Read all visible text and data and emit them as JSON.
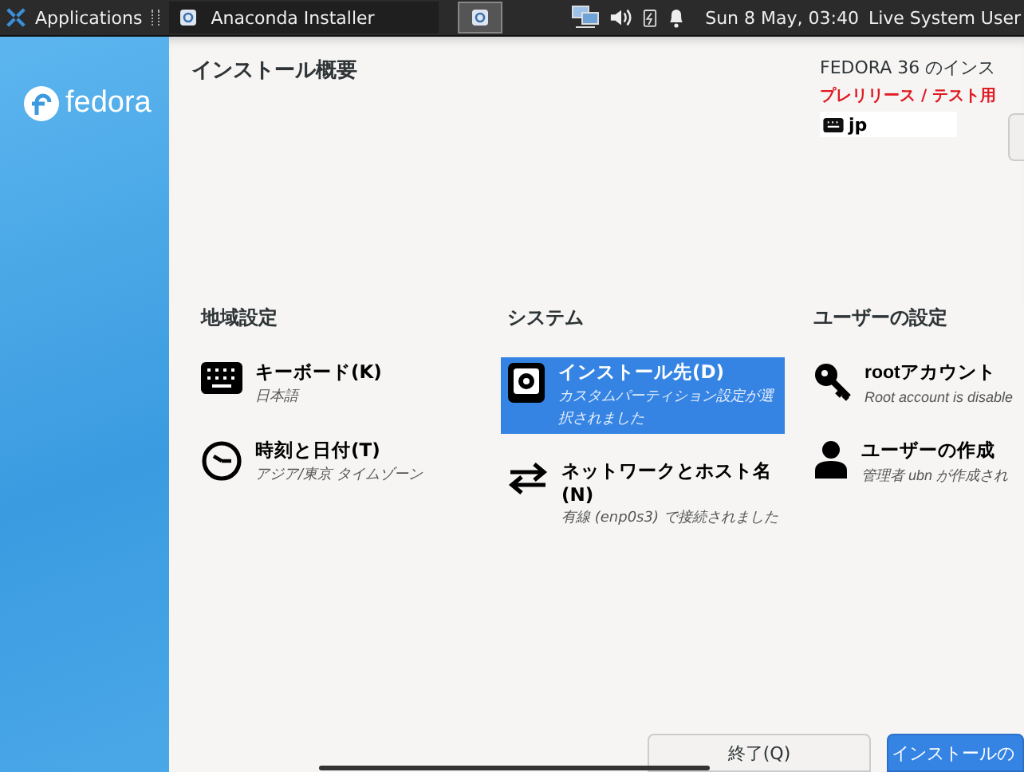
{
  "taskbar": {
    "apps_label": "Applications",
    "window_title": "Anaconda Installer",
    "clock": "Sun  8 May, 03:40",
    "user": "Live System User"
  },
  "sidebar": {
    "logo_text": "fedora"
  },
  "header": {
    "title": "インストール概要",
    "product": "FEDORA 36 のインス",
    "prerelease": "プレリリース / テスト用",
    "keyboard_layout": "jp"
  },
  "categories": [
    {
      "title": "地域設定",
      "spokes": [
        {
          "name": "キーボード(K)",
          "status": "日本語",
          "selected": false
        },
        {
          "name": "時刻と日付(T)",
          "status": "アジア/東京 タイムゾーン",
          "selected": false
        }
      ]
    },
    {
      "title": "システム",
      "spokes": [
        {
          "name": "インストール先(D)",
          "status": "カスタムパーティション設定が選択されました",
          "selected": true
        },
        {
          "name": "ネットワークとホスト名(N)",
          "status": "有線 (enp0s3) で接続されました",
          "selected": false
        }
      ]
    },
    {
      "title": "ユーザーの設定",
      "spokes": [
        {
          "name": "rootアカウント",
          "status": "Root account is disable",
          "selected": false
        },
        {
          "name": "ユーザーの作成",
          "status": "管理者 ubn が作成され",
          "selected": false
        }
      ]
    }
  ],
  "buttons": [
    {
      "label": "終了(Q)",
      "kind": "secondary"
    },
    {
      "label": "インストールの",
      "kind": "primary"
    }
  ]
}
